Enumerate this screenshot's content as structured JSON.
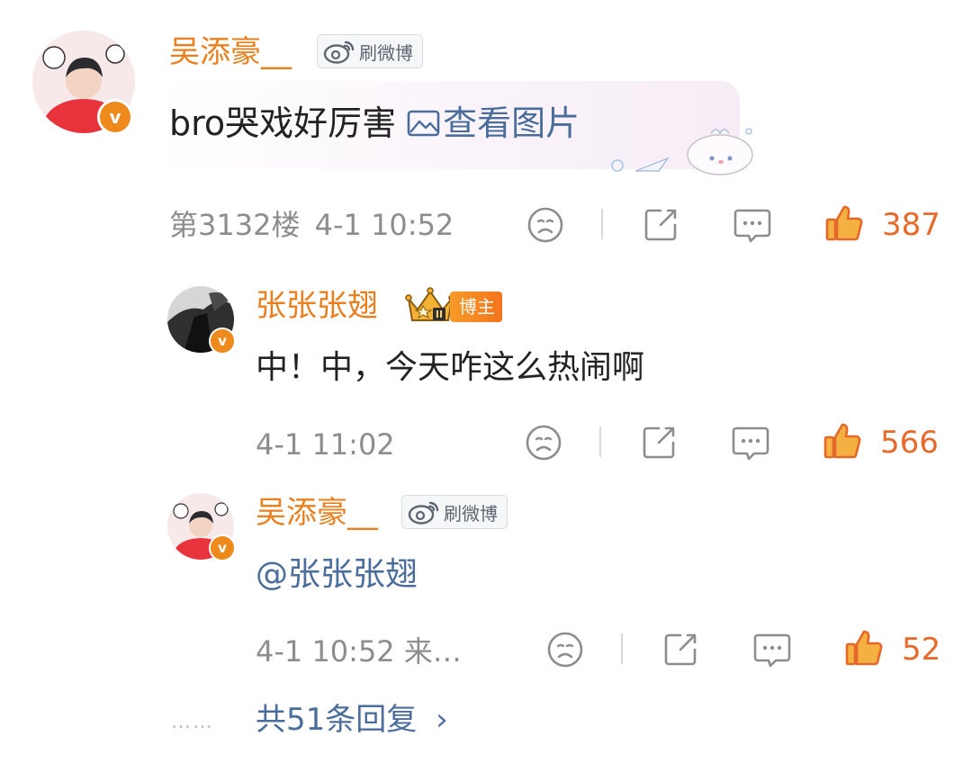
{
  "comment": {
    "username": "吴添豪__",
    "badge_label": "刷微博",
    "text": "bro哭戏好厉害",
    "image_link": "查看图片",
    "floor": "第3132楼",
    "time": "4-1 10:52",
    "like_count": "387",
    "avatar_v": "v"
  },
  "replies": [
    {
      "username": "张张张翅",
      "host_label": "博主",
      "crown_level": "II",
      "text": "中！中，今天咋这么热闹啊",
      "time": "4-1 11:02",
      "like_count": "566",
      "avatar_v": "v"
    },
    {
      "username": "吴添豪__",
      "badge_label": "刷微博",
      "text": "@张张张翅",
      "time": "4-1 10:52 来…",
      "like_count": "52",
      "avatar_v": "v"
    }
  ],
  "more_replies": {
    "dots": "……",
    "label": "共51条回复",
    "chevron": "›"
  },
  "colors": {
    "username": "#eb7f1d",
    "link": "#4b6d9c",
    "like": "#e86a2b",
    "meta": "#8d8d8d"
  },
  "icons": [
    "sad-face-icon",
    "share-icon",
    "comment-icon",
    "thumbs-up-icon",
    "weibo-logo-icon",
    "crown-icon",
    "picture-icon"
  ]
}
